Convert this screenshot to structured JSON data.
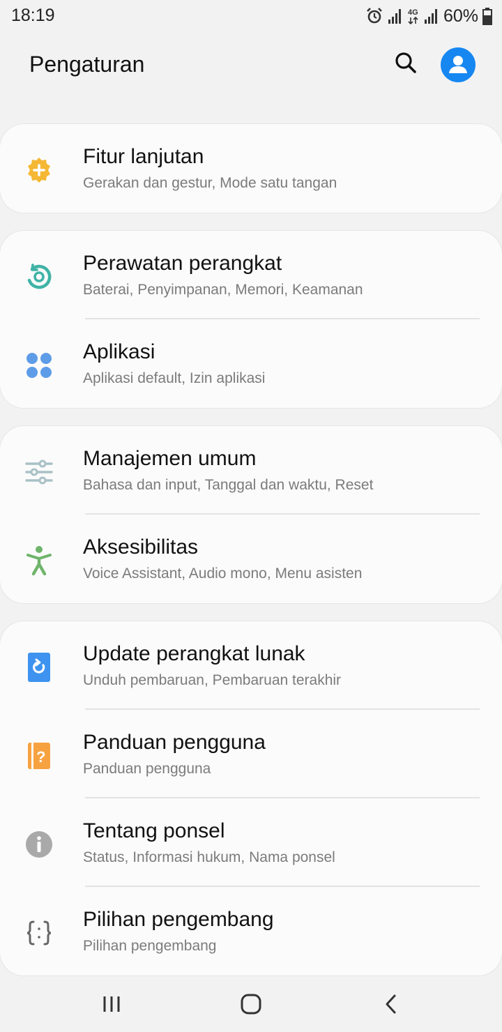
{
  "status_bar": {
    "time": "18:19",
    "network": "4G",
    "battery": "60%"
  },
  "header": {
    "title": "Pengaturan"
  },
  "groups": [
    {
      "items": [
        {
          "title": "Fitur lanjutan",
          "subtitle": "Gerakan dan gestur, Mode satu tangan",
          "icon": "advanced-features-icon",
          "color": "#f5b834"
        }
      ]
    },
    {
      "items": [
        {
          "title": "Perawatan perangkat",
          "subtitle": "Baterai, Penyimpanan, Memori, Keamanan",
          "icon": "device-care-icon",
          "color": "#3fb3a6"
        },
        {
          "title": "Aplikasi",
          "subtitle": "Aplikasi default, Izin aplikasi",
          "icon": "apps-icon",
          "color": "#5e9ce8"
        }
      ]
    },
    {
      "items": [
        {
          "title": "Manajemen umum",
          "subtitle": "Bahasa dan input, Tanggal dan waktu, Reset",
          "icon": "general-management-icon",
          "color": "#a9c1c6"
        },
        {
          "title": "Aksesibilitas",
          "subtitle": "Voice Assistant, Audio mono, Menu asisten",
          "icon": "accessibility-icon",
          "color": "#6fb46b"
        }
      ]
    },
    {
      "items": [
        {
          "title": "Update perangkat lunak",
          "subtitle": "Unduh pembaruan, Pembaruan terakhir",
          "icon": "software-update-icon",
          "color": "#3d93ef"
        },
        {
          "title": "Panduan pengguna",
          "subtitle": "Panduan pengguna",
          "icon": "user-manual-icon",
          "color": "#f7a240"
        },
        {
          "title": "Tentang ponsel",
          "subtitle": "Status, Informasi hukum, Nama ponsel",
          "icon": "info-icon",
          "color": "#a9a9a9"
        },
        {
          "title": "Pilihan pengembang",
          "subtitle": "Pilihan pengembang",
          "icon": "developer-options-icon",
          "color": "#666666"
        }
      ]
    }
  ],
  "colors": {
    "accent": "#1687f1",
    "background": "#f2f2f2",
    "card": "#fbfbfb"
  }
}
